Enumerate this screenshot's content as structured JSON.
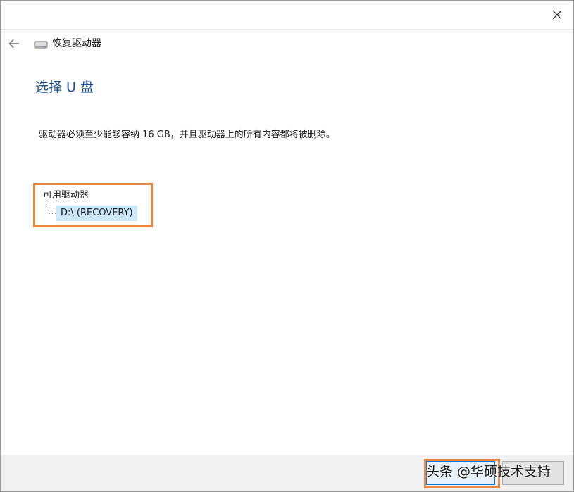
{
  "window": {
    "close_label": "✕"
  },
  "navbar": {
    "title": "恢复驱动器",
    "back_icon": "arrow-left-icon",
    "drive_icon": "drive-icon"
  },
  "main": {
    "heading": "选择 U 盘",
    "instructions": "驱动器必须至少能够容纳 16 GB，并且驱动器上的所有内容都将被删除。",
    "drive_list": {
      "header": "可用驱动器",
      "items": [
        {
          "label": "D:\\ (RECOVERY)",
          "selected": true
        }
      ]
    }
  },
  "footer": {
    "next_label": "",
    "cancel_label": ""
  },
  "watermark": {
    "text": "头条 @华硕技术支持"
  },
  "colors": {
    "heading": "#1d4f9c",
    "selection": "#cce8ff",
    "highlight": "#ee8642",
    "footer_bg": "#f0f0f0",
    "button_accent": "#0078d7"
  }
}
